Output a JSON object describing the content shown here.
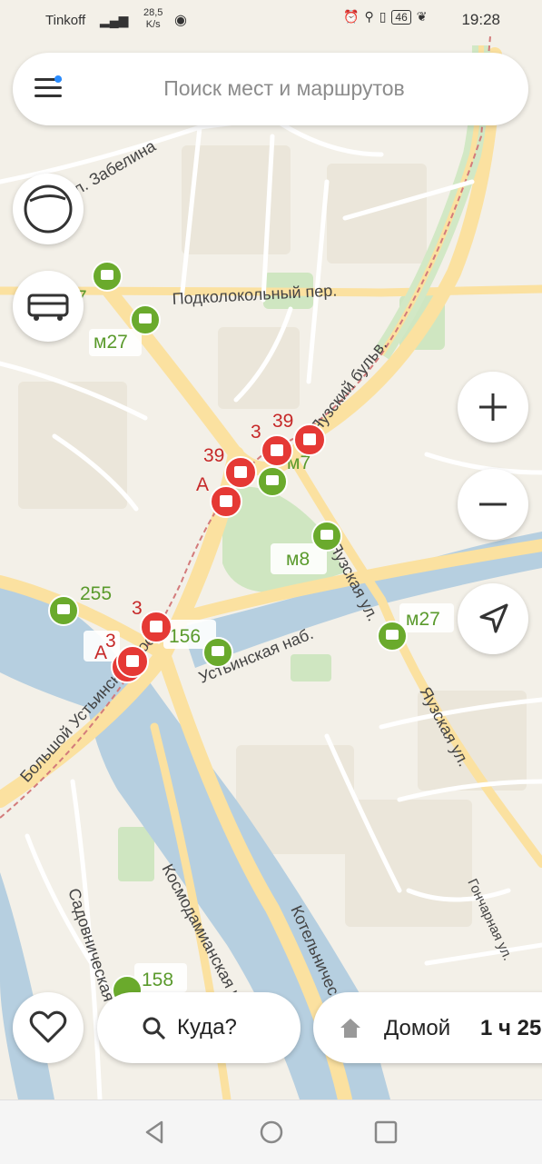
{
  "status_bar": {
    "carrier": "Tinkoff",
    "speed_value": "28,5",
    "speed_unit": "K/s",
    "battery": "46",
    "time": "19:28"
  },
  "search": {
    "placeholder": "Поиск мест и маршрутов"
  },
  "colors": {
    "transit_red": "#e53935",
    "transit_green": "#6aaa2c",
    "river": "#b6cfe0",
    "park": "#cde5c0",
    "road_major": "#fbe3a2",
    "road_minor": "#ffffff"
  },
  "map": {
    "streets": [
      "л. Забелина",
      "Подколокольный пер.",
      "Яузский бульв.",
      "Яузская ул.",
      "Устьинская наб.",
      "Большой Устьинский мост",
      "Космодамианская наб.",
      "Котельническая наб.",
      "Садовническая ул.",
      "Гончарная ул."
    ],
    "stops": [
      {
        "label": "м27",
        "type": "bus",
        "color": "green"
      },
      {
        "label": "7",
        "type": "bus",
        "color": "green"
      },
      {
        "label": "м7",
        "type": "bus",
        "color": "green"
      },
      {
        "label": "м8",
        "type": "bus",
        "color": "green"
      },
      {
        "label": "255",
        "type": "bus",
        "color": "green"
      },
      {
        "label": "156",
        "type": "bus",
        "color": "green"
      },
      {
        "label": "м27",
        "type": "bus",
        "color": "green"
      },
      {
        "label": "158",
        "type": "bus",
        "color": "green"
      },
      {
        "label": "39",
        "type": "tram",
        "color": "red"
      },
      {
        "label": "39",
        "type": "tram",
        "color": "red"
      },
      {
        "label": "А",
        "type": "tram",
        "color": "red"
      },
      {
        "label": "3",
        "type": "tram",
        "color": "red"
      },
      {
        "label": "3",
        "type": "tram",
        "color": "red"
      },
      {
        "label": "3",
        "type": "tram",
        "color": "red"
      },
      {
        "label": "А",
        "type": "tram",
        "color": "red"
      }
    ]
  },
  "buttons": {
    "layers_icon": "layers-icon",
    "transport_icon": "bus-icon",
    "zoom_in_icon": "plus-icon",
    "zoom_out_icon": "minus-icon",
    "location_icon": "navigation-arrow-icon",
    "favorites_icon": "heart-icon"
  },
  "bottom": {
    "where_label": "Куда?",
    "home_label": "Домой",
    "home_time": "1 ч 25"
  }
}
